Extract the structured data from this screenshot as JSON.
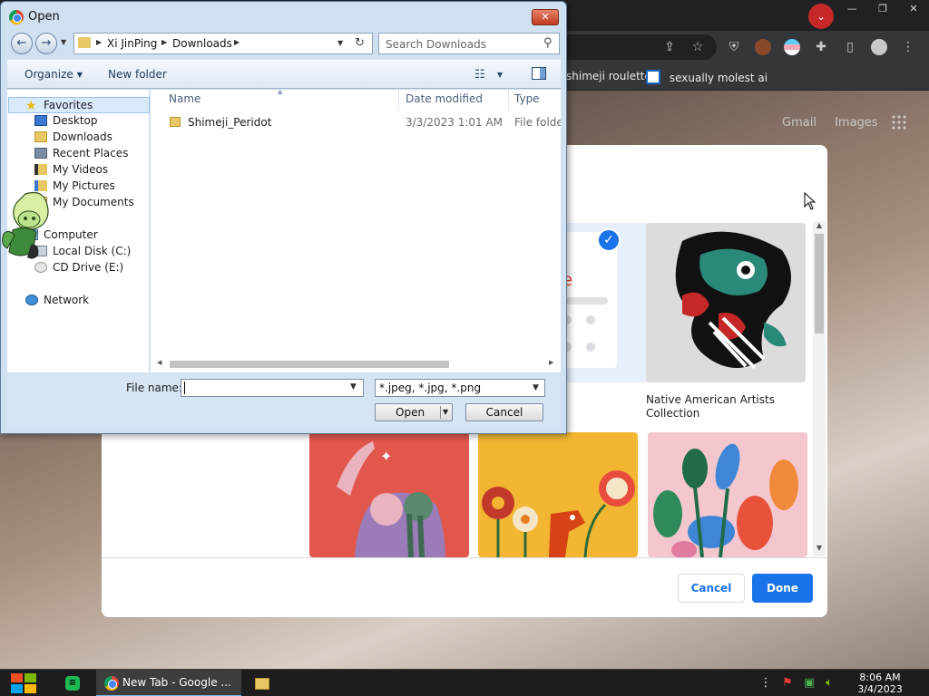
{
  "browser": {
    "bookmarks": [
      "shimeji roulette",
      "sexually molest ai"
    ],
    "ntp_links": [
      "Gmail",
      "Images"
    ]
  },
  "customize": {
    "tiles": [
      {
        "id": "google",
        "caption": ""
      },
      {
        "id": "native",
        "caption": "Native American Artists Collection"
      },
      {
        "id": "women",
        "caption": ""
      },
      {
        "id": "flowers",
        "caption": ""
      },
      {
        "id": "plants",
        "caption": ""
      }
    ],
    "cancel_label": "Cancel",
    "done_label": "Done",
    "accent": "#1a73e8",
    "google_fragment": "gle"
  },
  "open_dialog": {
    "title": "Open",
    "breadcrumbs": [
      "Xi JinPing",
      "Downloads"
    ],
    "search_placeholder": "Search Downloads",
    "toolbar": {
      "organize": "Organize",
      "new_folder": "New folder"
    },
    "nav": {
      "favorites": "Favorites",
      "desktop": "Desktop",
      "downloads": "Downloads",
      "recent": "Recent Places",
      "videos": "My Videos",
      "pictures": "My Pictures",
      "documents": "My Documents",
      "computer": "Computer",
      "local_disk": "Local Disk (C:)",
      "cd_drive": "CD Drive (E:)",
      "network": "Network"
    },
    "columns": {
      "name": "Name",
      "date": "Date modified",
      "type": "Type"
    },
    "files": [
      {
        "name": "Shimeji_Peridot",
        "date": "3/3/2023 1:01 AM",
        "type": "File folder"
      }
    ],
    "file_name_label": "File name:",
    "file_name_value": "",
    "file_type": "*.jpeg, *.jpg, *.png",
    "open_label": "Open",
    "cancel_label": "Cancel"
  },
  "taskbar": {
    "active_task": "New Tab - Google ...",
    "time": "8:06 AM",
    "date": "3/4/2023"
  }
}
